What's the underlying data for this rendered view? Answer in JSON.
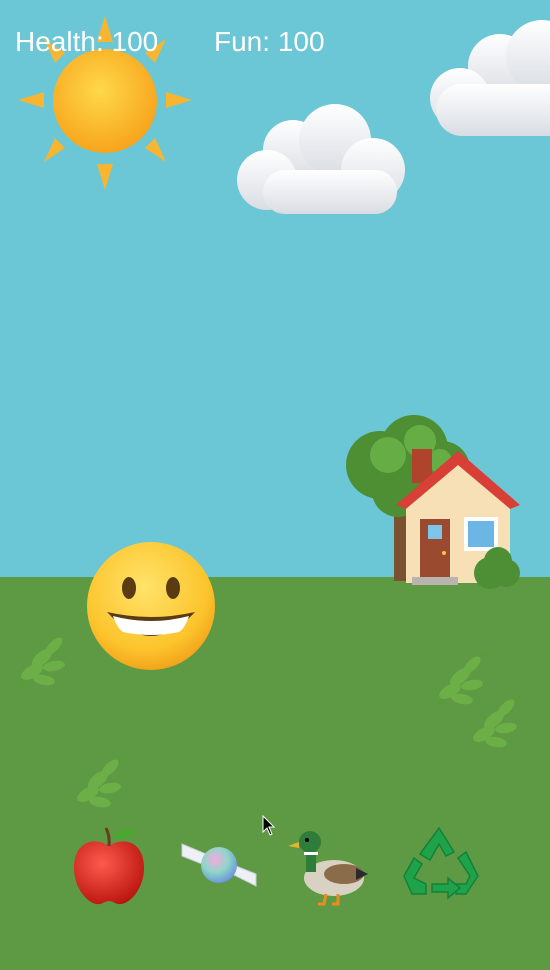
{
  "hud": {
    "health_label": "Health:",
    "health_value": "100",
    "fun_label": "Fun:",
    "fun_value": "100"
  },
  "toolbar": {
    "items": [
      {
        "icon": "apple-icon",
        "action": "feed"
      },
      {
        "icon": "candy-icon",
        "action": "treat"
      },
      {
        "icon": "duck-icon",
        "action": "play"
      },
      {
        "icon": "recycle-icon",
        "action": "clean"
      }
    ]
  },
  "colors": {
    "sky": "#6bc7d6",
    "grass": "#5e9a44",
    "hud_text": "#ffffff"
  }
}
